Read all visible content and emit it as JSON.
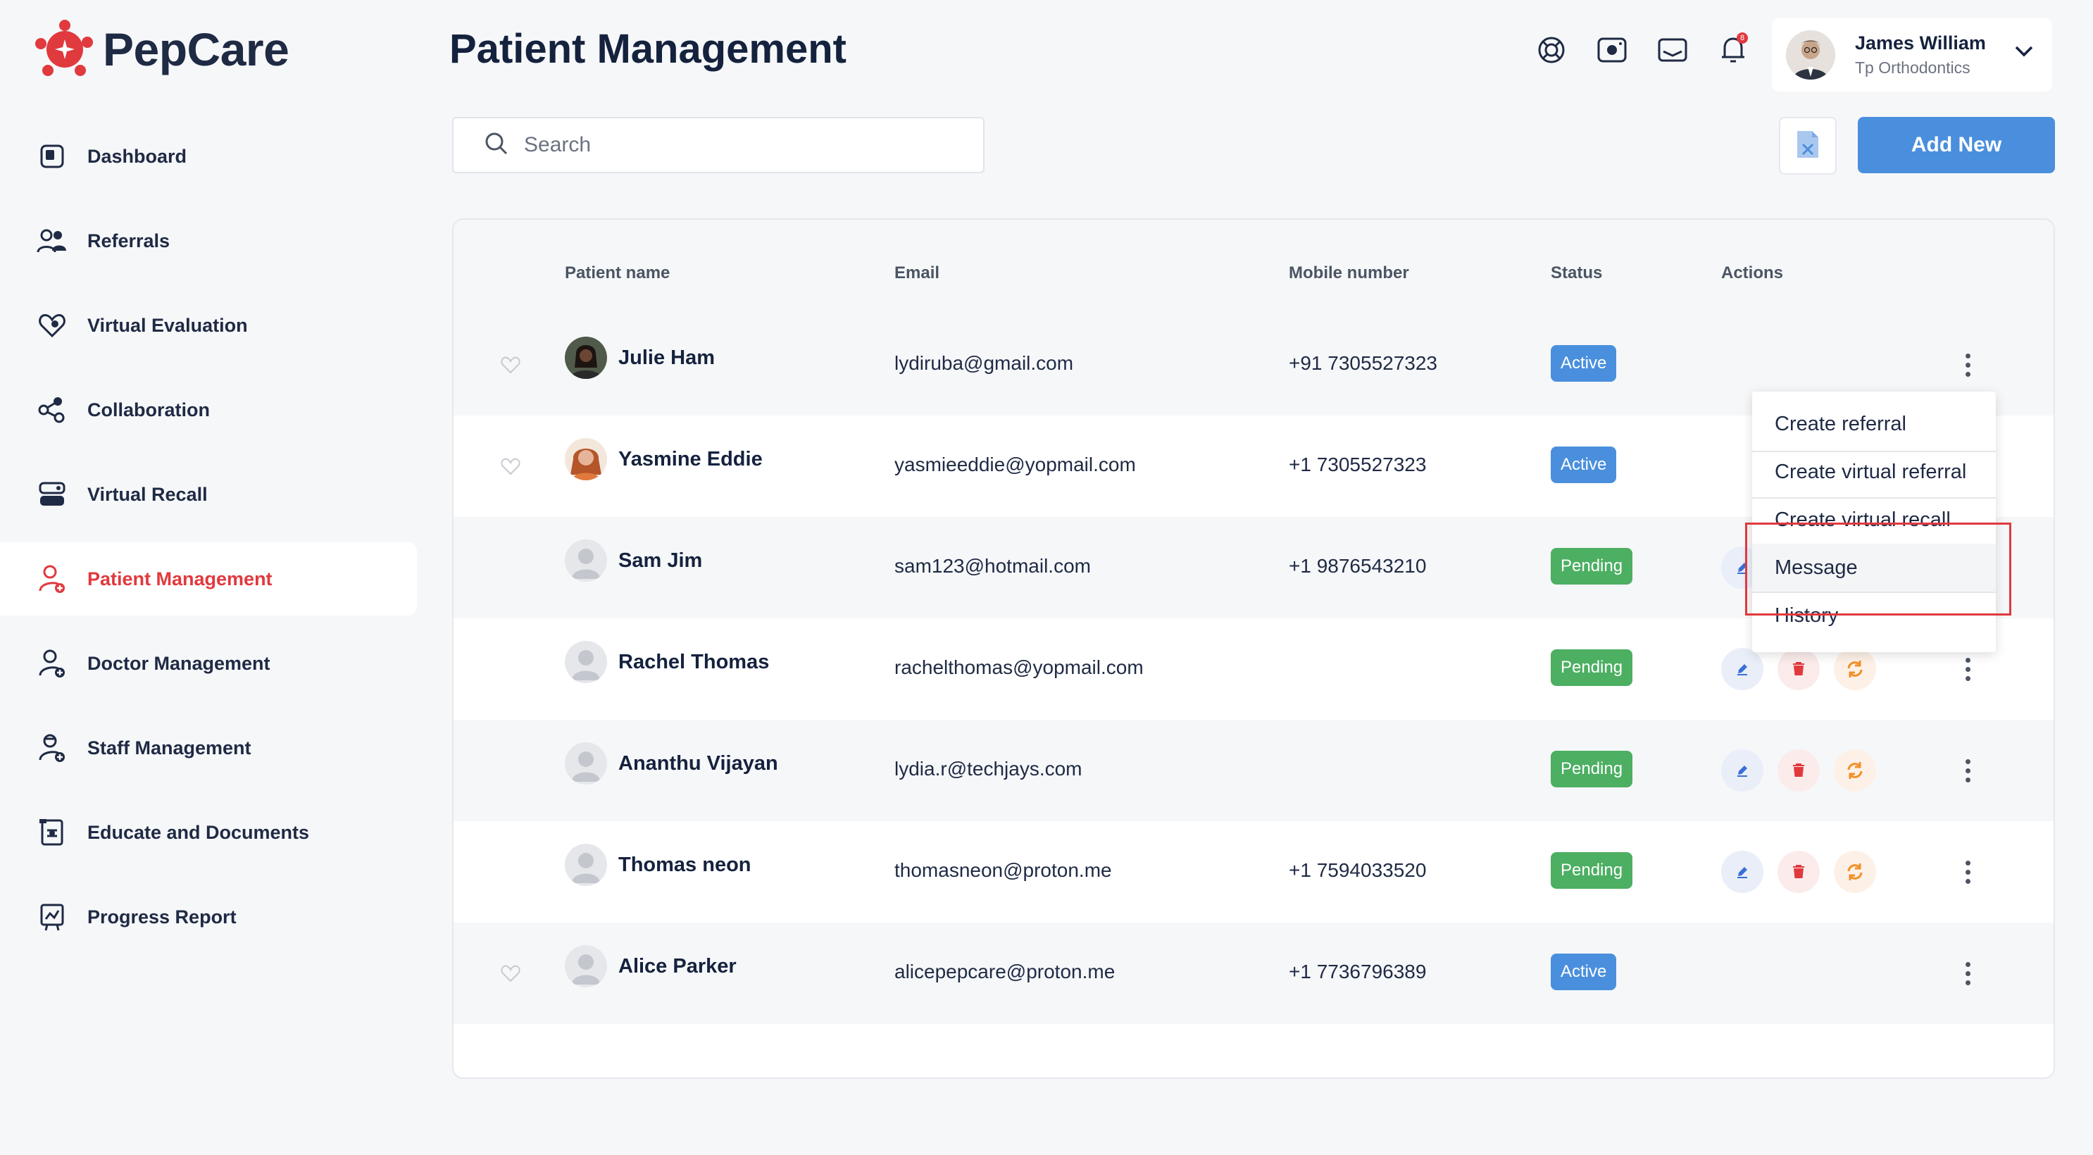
{
  "app": {
    "name": "PepCare",
    "brand_color": "#e0393e",
    "accent_color": "#4a8fdd"
  },
  "sidebar": {
    "items": [
      {
        "label": "Dashboard",
        "icon": "dashboard-icon"
      },
      {
        "label": "Referrals",
        "icon": "users-icon"
      },
      {
        "label": "Virtual Evaluation",
        "icon": "heart-icon"
      },
      {
        "label": "Collaboration",
        "icon": "collaboration-icon"
      },
      {
        "label": "Virtual Recall",
        "icon": "recall-icon"
      },
      {
        "label": "Patient Management",
        "icon": "patient-icon",
        "active": true
      },
      {
        "label": "Doctor Management",
        "icon": "doctor-icon"
      },
      {
        "label": "Staff Management",
        "icon": "staff-icon"
      },
      {
        "label": "Educate and Documents",
        "icon": "document-icon"
      },
      {
        "label": "Progress Report",
        "icon": "report-icon"
      }
    ]
  },
  "header": {
    "title": "Patient Management",
    "notification_count": "8",
    "user": {
      "name": "James William",
      "subtitle": "Tp Orthodontics"
    }
  },
  "toolbar": {
    "search_placeholder": "Search",
    "add_label": "Add New"
  },
  "table": {
    "columns": [
      "Patient name",
      "Email",
      "Mobile number",
      "Status",
      "Actions"
    ],
    "rows": [
      {
        "name": "Julie Ham",
        "email": "lydiruba@gmail.com",
        "mobile": "+91 7305527323",
        "status": "Active"
      },
      {
        "name": "Yasmine Eddie",
        "email": "yasmieeddie@yopmail.com",
        "mobile": "+1 7305527323",
        "status": "Active"
      },
      {
        "name": "Sam Jim",
        "email": "sam123@hotmail.com",
        "mobile": "+1 9876543210",
        "status": "Pending"
      },
      {
        "name": "Rachel Thomas",
        "email": "rachelthomas@yopmail.com",
        "mobile": "",
        "status": "Pending"
      },
      {
        "name": "Ananthu Vijayan",
        "email": "lydia.r@techjays.com",
        "mobile": "",
        "status": "Pending"
      },
      {
        "name": "Thomas neon",
        "email": "thomasneon@proton.me",
        "mobile": "+1 7594033520",
        "status": "Pending"
      },
      {
        "name": "Alice Parker",
        "email": "alicepepcare@proton.me",
        "mobile": "+1 7736796389",
        "status": "Active"
      }
    ]
  },
  "context_menu": {
    "items": [
      "Create referral",
      "Create virtual referral",
      "Create virtual recall",
      "Message",
      "History"
    ],
    "highlighted": "Message"
  }
}
